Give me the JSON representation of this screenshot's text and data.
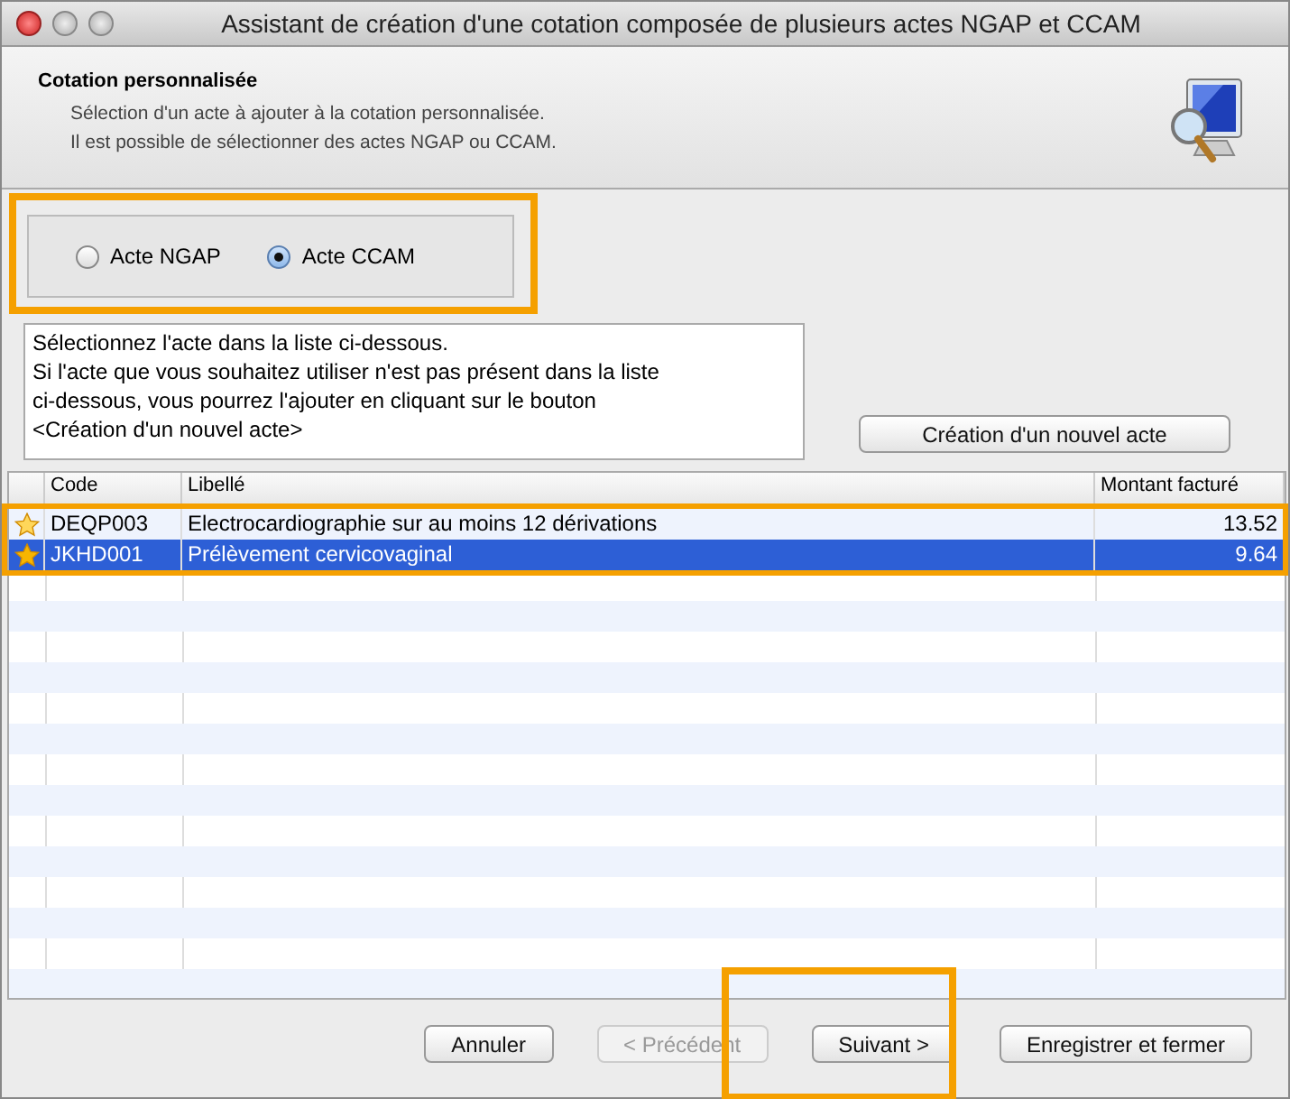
{
  "window": {
    "title": "Assistant de création d'une cotation composée de plusieurs actes NGAP et CCAM"
  },
  "header": {
    "title": "Cotation personnalisée",
    "lines": [
      "Sélection d'un acte à ajouter à la cotation personnalisée.",
      "Il est possible de sélectionner des actes NGAP ou CCAM."
    ]
  },
  "radios": [
    {
      "label": "Acte NGAP",
      "selected": false
    },
    {
      "label": "Acte CCAM",
      "selected": true
    }
  ],
  "instructions": [
    "Sélectionnez l'acte dans la liste ci-dessous.",
    "Si l'acte que vous souhaitez utiliser n'est pas présent dans la liste",
    "ci-dessous, vous pourrez l'ajouter en cliquant sur le bouton",
    "<Création d'un nouvel acte>"
  ],
  "new_act_button": "Création d'un nouvel acte",
  "table": {
    "columns": [
      "Code",
      "Libellé",
      "Montant facturé"
    ],
    "rows": [
      {
        "code": "DEQP003",
        "label": "Electrocardiographie sur au moins 12 dérivations",
        "amount": "13.52",
        "selected": false
      },
      {
        "code": "JKHD001",
        "label": "Prélèvement cervicovaginal",
        "amount": "9.64",
        "selected": true
      }
    ]
  },
  "buttons": [
    {
      "label": "Annuler",
      "disabled": false
    },
    {
      "label": "< Précédent",
      "disabled": true
    },
    {
      "label": "Suivant >",
      "disabled": false
    },
    {
      "label": "Enregistrer et fermer",
      "disabled": false
    }
  ]
}
